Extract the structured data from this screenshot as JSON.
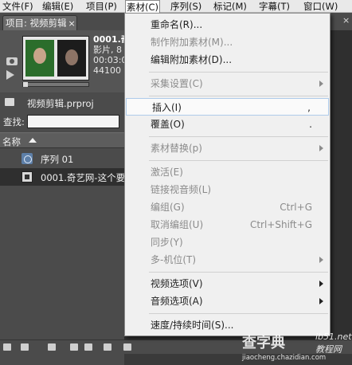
{
  "menubar": {
    "items": [
      "文件(F)",
      "编辑(E)",
      "项目(P)",
      "素材(C)",
      "序列(S)",
      "标记(M)",
      "字幕(T)",
      "窗口(W)"
    ]
  },
  "project_panel": {
    "tab_title": "项目: 视频剪辑",
    "tab_close": "×",
    "clip_name": "0001.奇",
    "clip_type": "影片, 8",
    "clip_duration": "00:03:0",
    "clip_audio": "44100 H",
    "project_file": "视频剪辑.prproj",
    "search_label": "查找:",
    "search_value": "",
    "column_name": "名称",
    "items": [
      {
        "label": "序列 01",
        "icon": "sequence-icon"
      },
      {
        "label": "0001.奇艺网-这个要",
        "icon": "clip-icon"
      }
    ]
  },
  "right_panel": {
    "close_glyph": "×"
  },
  "dropdown": {
    "items": [
      {
        "label": "重命名(R)...",
        "shortcut": "",
        "submenu": false,
        "disabled": false
      },
      {
        "label": "制作附加素材(M)...",
        "shortcut": "",
        "submenu": false,
        "disabled": true
      },
      {
        "label": "编辑附加素材(D)...",
        "shortcut": "",
        "submenu": false,
        "disabled": false
      },
      {
        "label": "采集设置(C)",
        "shortcut": "",
        "submenu": true,
        "disabled": true
      },
      {
        "label": "插入(I)",
        "shortcut": ",",
        "submenu": false,
        "disabled": false,
        "highlight": true
      },
      {
        "label": "覆盖(O)",
        "shortcut": ".",
        "submenu": false,
        "disabled": false
      },
      {
        "label": "素材替换(p)",
        "shortcut": "",
        "submenu": true,
        "disabled": true
      },
      {
        "label": "激活(E)",
        "shortcut": "",
        "submenu": false,
        "disabled": true
      },
      {
        "label": "链接视音频(L)",
        "shortcut": "",
        "submenu": false,
        "disabled": true
      },
      {
        "label": "编组(G)",
        "shortcut": "Ctrl+G",
        "submenu": false,
        "disabled": true
      },
      {
        "label": "取消编组(U)",
        "shortcut": "Ctrl+Shift+G",
        "submenu": false,
        "disabled": true
      },
      {
        "label": "同步(Y)",
        "shortcut": "",
        "submenu": false,
        "disabled": true
      },
      {
        "label": "多-机位(T)",
        "shortcut": "",
        "submenu": true,
        "disabled": true
      },
      {
        "label": "视频选项(V)",
        "shortcut": "",
        "submenu": true,
        "disabled": false
      },
      {
        "label": "音频选项(A)",
        "shortcut": "",
        "submenu": true,
        "disabled": false
      },
      {
        "label": "速度/持续时间(S)...",
        "shortcut": "",
        "submenu": false,
        "disabled": false
      }
    ]
  },
  "watermark": {
    "brand": "查字典",
    "site": "ib51.net",
    "badge": "教程网",
    "url": "jiaocheng.chazidian.com"
  }
}
